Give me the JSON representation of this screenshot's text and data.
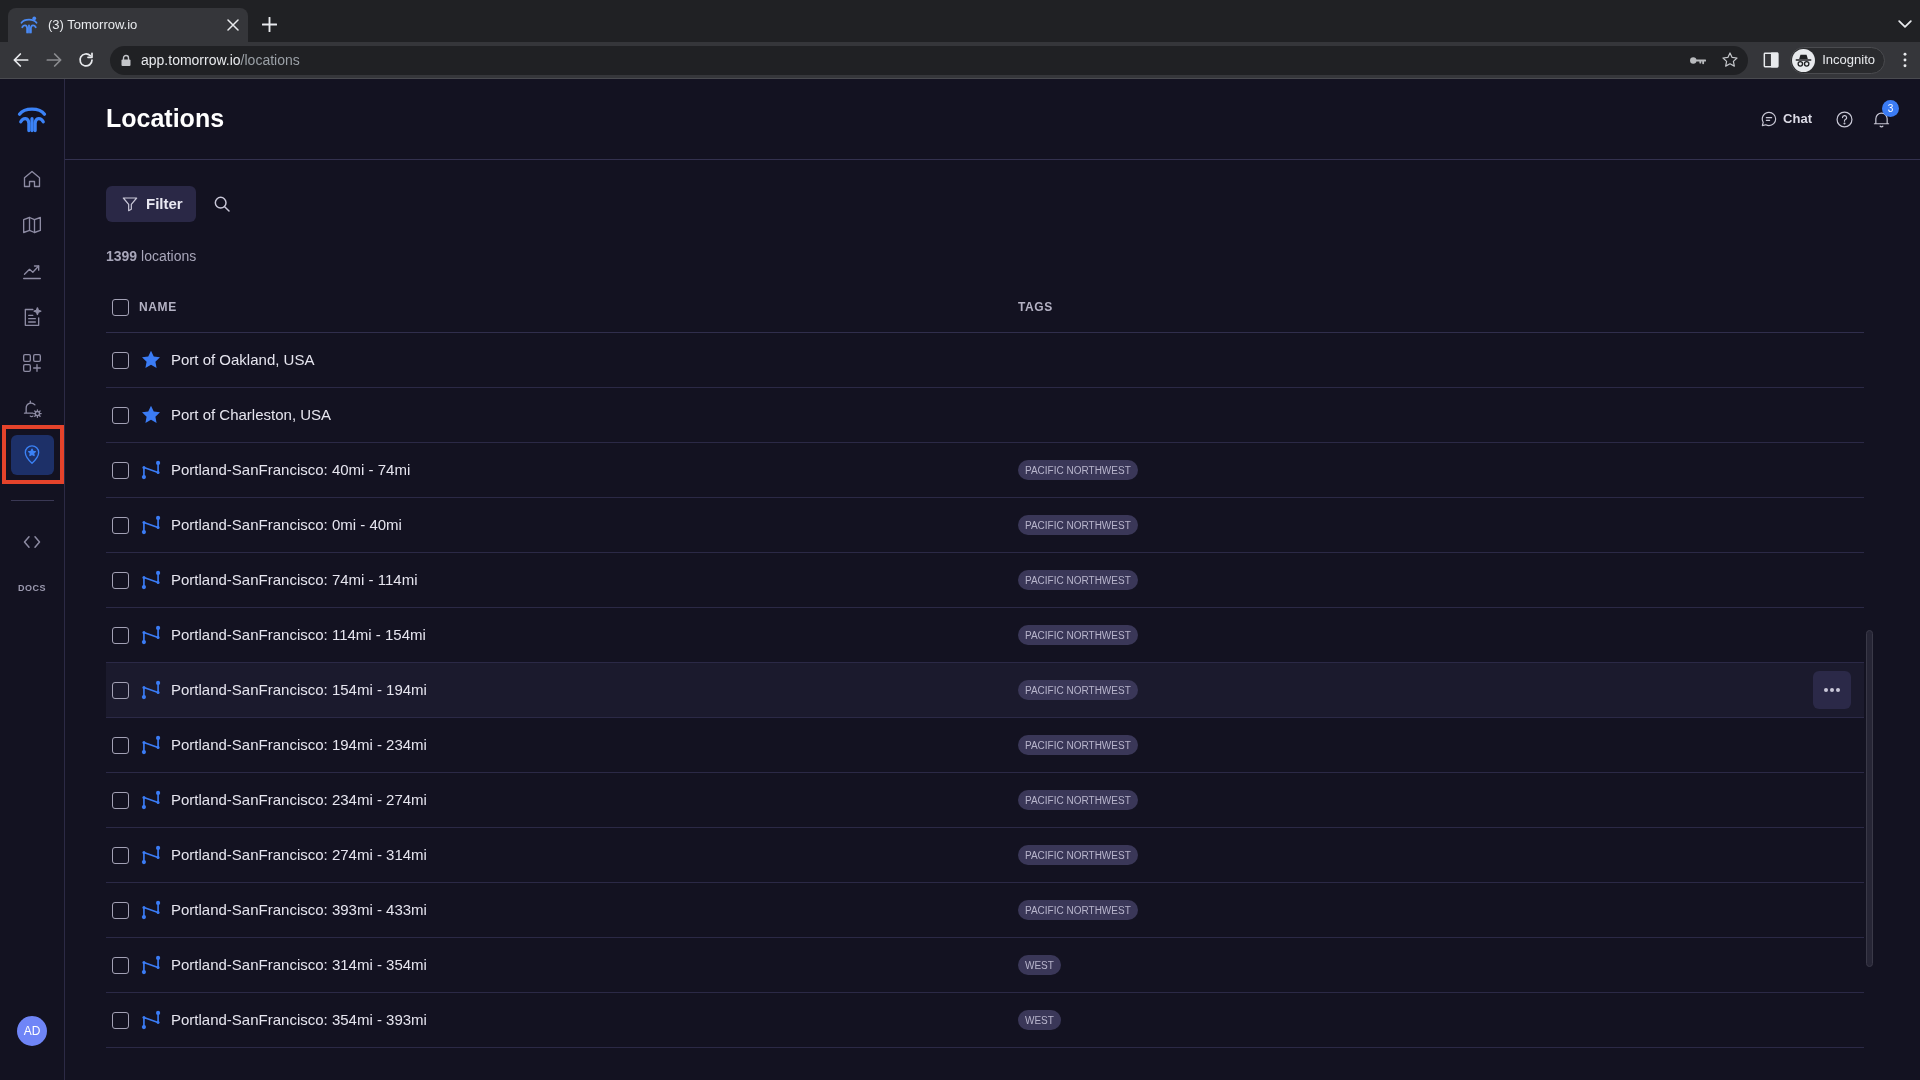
{
  "browser": {
    "tab_title": "(3) Tomorrow.io",
    "url_host": "app.tomorrow.io",
    "url_path": "/locations",
    "profile_label": "Incognito"
  },
  "sidebar": {
    "nav_items": [
      {
        "selected": false,
        "highlighted": false
      },
      {
        "selected": false,
        "highlighted": false
      },
      {
        "selected": false,
        "highlighted": false
      },
      {
        "selected": false,
        "highlighted": false
      },
      {
        "selected": false,
        "highlighted": false
      },
      {
        "selected": false,
        "highlighted": false
      },
      {
        "selected": true,
        "highlighted": true
      }
    ],
    "docs_label": "DOCS",
    "avatar_initials": "AD"
  },
  "header": {
    "title": "Locations",
    "chat_label": "Chat",
    "notification_count": "3"
  },
  "toolbar": {
    "filter_label": "Filter"
  },
  "summary": "**1399** locations",
  "table": {
    "all_checked": false,
    "columns": [
      "NAME",
      "TAGS"
    ],
    "rows": [
      {
        "kind": "favorite",
        "name": "Port of Oakland, USA",
        "checked": false,
        "hovered": false
      },
      {
        "kind": "favorite",
        "name": "Port of Charleston, USA",
        "checked": false,
        "hovered": false
      },
      {
        "kind": "route",
        "name": "Portland-SanFrancisco: 40mi - 74mi",
        "tags": [
          "PACIFIC NORTHWEST"
        ],
        "checked": false,
        "hovered": false
      },
      {
        "kind": "route",
        "name": "Portland-SanFrancisco: 0mi - 40mi",
        "tags": [
          "PACIFIC NORTHWEST"
        ],
        "checked": false,
        "hovered": false
      },
      {
        "kind": "route",
        "name": "Portland-SanFrancisco: 74mi - 114mi",
        "tags": [
          "PACIFIC NORTHWEST"
        ],
        "checked": false,
        "hovered": false
      },
      {
        "kind": "route",
        "name": "Portland-SanFrancisco: 114mi - 154mi",
        "tags": [
          "PACIFIC NORTHWEST"
        ],
        "checked": false,
        "hovered": false
      },
      {
        "kind": "route",
        "name": "Portland-SanFrancisco: 154mi - 194mi",
        "tags": [
          "PACIFIC NORTHWEST"
        ],
        "checked": false,
        "hovered": true
      },
      {
        "kind": "route",
        "name": "Portland-SanFrancisco: 194mi - 234mi",
        "tags": [
          "PACIFIC NORTHWEST"
        ],
        "checked": false,
        "hovered": false
      },
      {
        "kind": "route",
        "name": "Portland-SanFrancisco: 234mi - 274mi",
        "tags": [
          "PACIFIC NORTHWEST"
        ],
        "checked": false,
        "hovered": false
      },
      {
        "kind": "route",
        "name": "Portland-SanFrancisco: 274mi - 314mi",
        "tags": [
          "PACIFIC NORTHWEST"
        ],
        "checked": false,
        "hovered": false
      },
      {
        "kind": "route",
        "name": "Portland-SanFrancisco: 393mi - 433mi",
        "tags": [
          "PACIFIC NORTHWEST"
        ],
        "checked": false,
        "hovered": false
      },
      {
        "kind": "route",
        "name": "Portland-SanFrancisco: 314mi - 354mi",
        "tags": [
          "WEST"
        ],
        "checked": false,
        "hovered": false
      },
      {
        "kind": "route",
        "name": "Portland-SanFrancisco: 354mi - 393mi",
        "tags": [
          "WEST"
        ],
        "checked": false,
        "hovered": false
      }
    ]
  }
}
